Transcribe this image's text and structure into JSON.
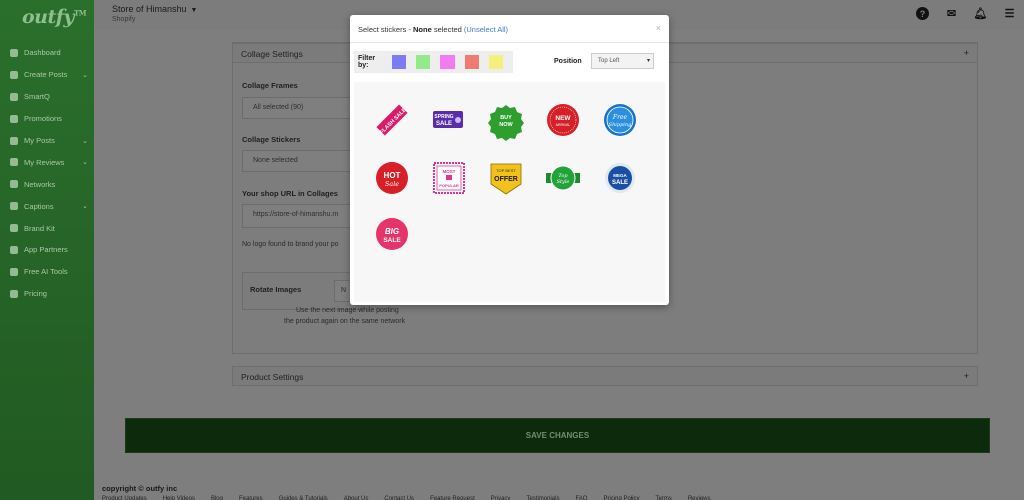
{
  "app": {
    "logo": "outfy",
    "logo_tm": "TM"
  },
  "sidebar": {
    "items": [
      {
        "label": "Dashboard",
        "icon": "dashboard-icon",
        "chevron": false
      },
      {
        "label": "Create Posts",
        "icon": "pencil-icon",
        "chevron": true
      },
      {
        "label": "SmartQ",
        "icon": "smartq-icon",
        "chevron": false
      },
      {
        "label": "Promotions",
        "icon": "globe-icon",
        "chevron": false
      },
      {
        "label": "My Posts",
        "icon": "posts-icon",
        "chevron": true
      },
      {
        "label": "My Reviews",
        "icon": "star-icon",
        "chevron": true
      },
      {
        "label": "Networks",
        "icon": "wifi-icon",
        "chevron": false
      },
      {
        "label": "Captions",
        "icon": "captions-icon",
        "chevron": true
      },
      {
        "label": "Brand Kit",
        "icon": "brand-kit-icon",
        "chevron": false
      },
      {
        "label": "App Partners",
        "icon": "users-icon",
        "chevron": false
      },
      {
        "label": "Free AI Tools",
        "icon": "tools-icon",
        "chevron": false
      },
      {
        "label": "Pricing",
        "icon": "tag-icon",
        "chevron": false
      }
    ]
  },
  "header": {
    "store_name": "Store of Himanshu",
    "store_platform": "Shopify"
  },
  "settings": {
    "collage_section": "Collage Settings",
    "collage_frames_label": "Collage Frames",
    "collage_frames_value": "All selected (90)",
    "collage_stickers_label": "Collage Stickers",
    "collage_stickers_value": "None selected",
    "shop_url_label": "Your shop URL in Collages",
    "shop_url_value": "https://store-of-himanshu.m",
    "logo_note": "No logo found to brand your po",
    "rotate_label": "Rotate Images",
    "rotate_value": "N",
    "rotate_help_1": "Use the next image while posting",
    "rotate_help_2": "the product again on the same network",
    "product_section": "Product Settings",
    "save_button": "SAVE CHANGES"
  },
  "footer": {
    "copyright": "copyright © outfy inc",
    "links": [
      "Product Updates",
      "Help Videos",
      "Blog",
      "Features",
      "Guides & Tutorials",
      "About Us",
      "Contact Us",
      "Feature Request",
      "Privacy",
      "Testimonials",
      "FAQ",
      "Pricing Policy",
      "Terms",
      "Reviews"
    ]
  },
  "modal": {
    "title_prefix": "Select stickers - ",
    "title_selected": "None",
    "title_suffix": " selected ",
    "unselect": "(Unselect All)",
    "close": "×",
    "filter_label": "Filter by:",
    "filter_colors": [
      "#7b7cf2",
      "#93ea8a",
      "#f07cf0",
      "#f07a72",
      "#f3f07c"
    ],
    "position_label": "Position",
    "position_value": "Top Left",
    "stickers": [
      {
        "name": "flash-sale",
        "text": "FLASH SALE"
      },
      {
        "name": "spring-sale",
        "text": "SPRING SALE"
      },
      {
        "name": "buy-now",
        "text": "BUY NOW"
      },
      {
        "name": "new-arrival",
        "text": "NEW ARRIVAL"
      },
      {
        "name": "free-shipping",
        "text": "Free Shipping"
      },
      {
        "name": "hot-sale",
        "text": "HOT Sale"
      },
      {
        "name": "most-popular",
        "text": "MOST POPULAR"
      },
      {
        "name": "top-best-offer",
        "text": "TOP BEST OFFER"
      },
      {
        "name": "top-style",
        "text": "Top Style"
      },
      {
        "name": "mega-sale",
        "text": "MEGA SALE"
      },
      {
        "name": "big-sale",
        "text": "BIG SALE"
      }
    ]
  }
}
